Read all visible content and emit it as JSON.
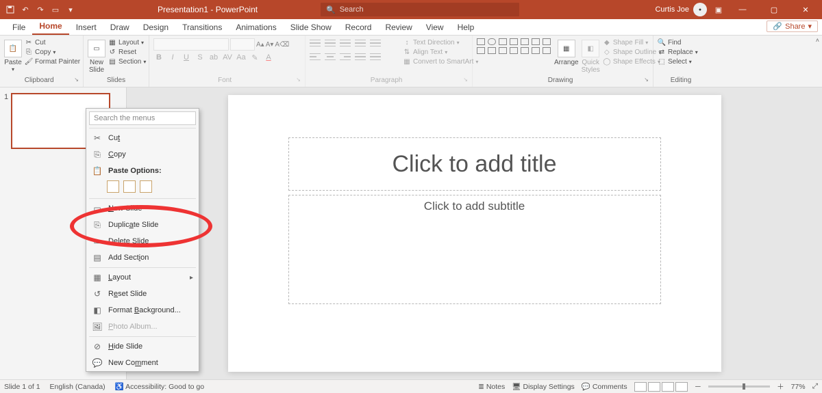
{
  "title_bar": {
    "doc_title": "Presentation1 - PowerPoint",
    "search_placeholder": "Search",
    "user_name": "Curtis Joe"
  },
  "tabs": {
    "file": "File",
    "home": "Home",
    "insert": "Insert",
    "draw": "Draw",
    "design": "Design",
    "transitions": "Transitions",
    "animations": "Animations",
    "slideshow": "Slide Show",
    "record": "Record",
    "review": "Review",
    "view": "View",
    "help": "Help",
    "share": "Share"
  },
  "ribbon": {
    "clipboard": {
      "label": "Clipboard",
      "paste": "Paste",
      "cut": "Cut",
      "copy": "Copy",
      "fp": "Format Painter"
    },
    "slides": {
      "label": "Slides",
      "new": "New\nSlide",
      "layout": "Layout",
      "reset": "Reset",
      "section": "Section"
    },
    "font": {
      "label": "Font"
    },
    "paragraph": {
      "label": "Paragraph",
      "td": "Text Direction",
      "at": "Align Text",
      "sa": "Convert to SmartArt"
    },
    "drawing": {
      "label": "Drawing",
      "arrange": "Arrange",
      "qs": "Quick\nStyles",
      "sf": "Shape Fill",
      "so": "Shape Outline",
      "se": "Shape Effects"
    },
    "editing": {
      "label": "Editing",
      "find": "Find",
      "replace": "Replace",
      "select": "Select"
    }
  },
  "thumb": {
    "num": "1"
  },
  "slide": {
    "title_ph": "Click to add title",
    "sub_ph": "Click to add subtitle"
  },
  "ctx": {
    "search_ph": "Search the menus",
    "cut": "Cut",
    "copy": "Copy",
    "paste_opts": "Paste Options:",
    "new_slide": "New Slide",
    "dup": "Duplicate Slide",
    "del": "Delete Slide",
    "add_sec": "Add Section",
    "layout": "Layout",
    "reset": "Reset Slide",
    "fmt_bg": "Format Background...",
    "photo": "Photo Album...",
    "hide": "Hide Slide",
    "comment": "New Comment"
  },
  "status": {
    "slide": "Slide 1 of 1",
    "lang": "English (Canada)",
    "acc": "Accessibility: Good to go",
    "notes": "Notes",
    "disp": "Display Settings",
    "comments": "Comments",
    "zoom": "77%"
  }
}
